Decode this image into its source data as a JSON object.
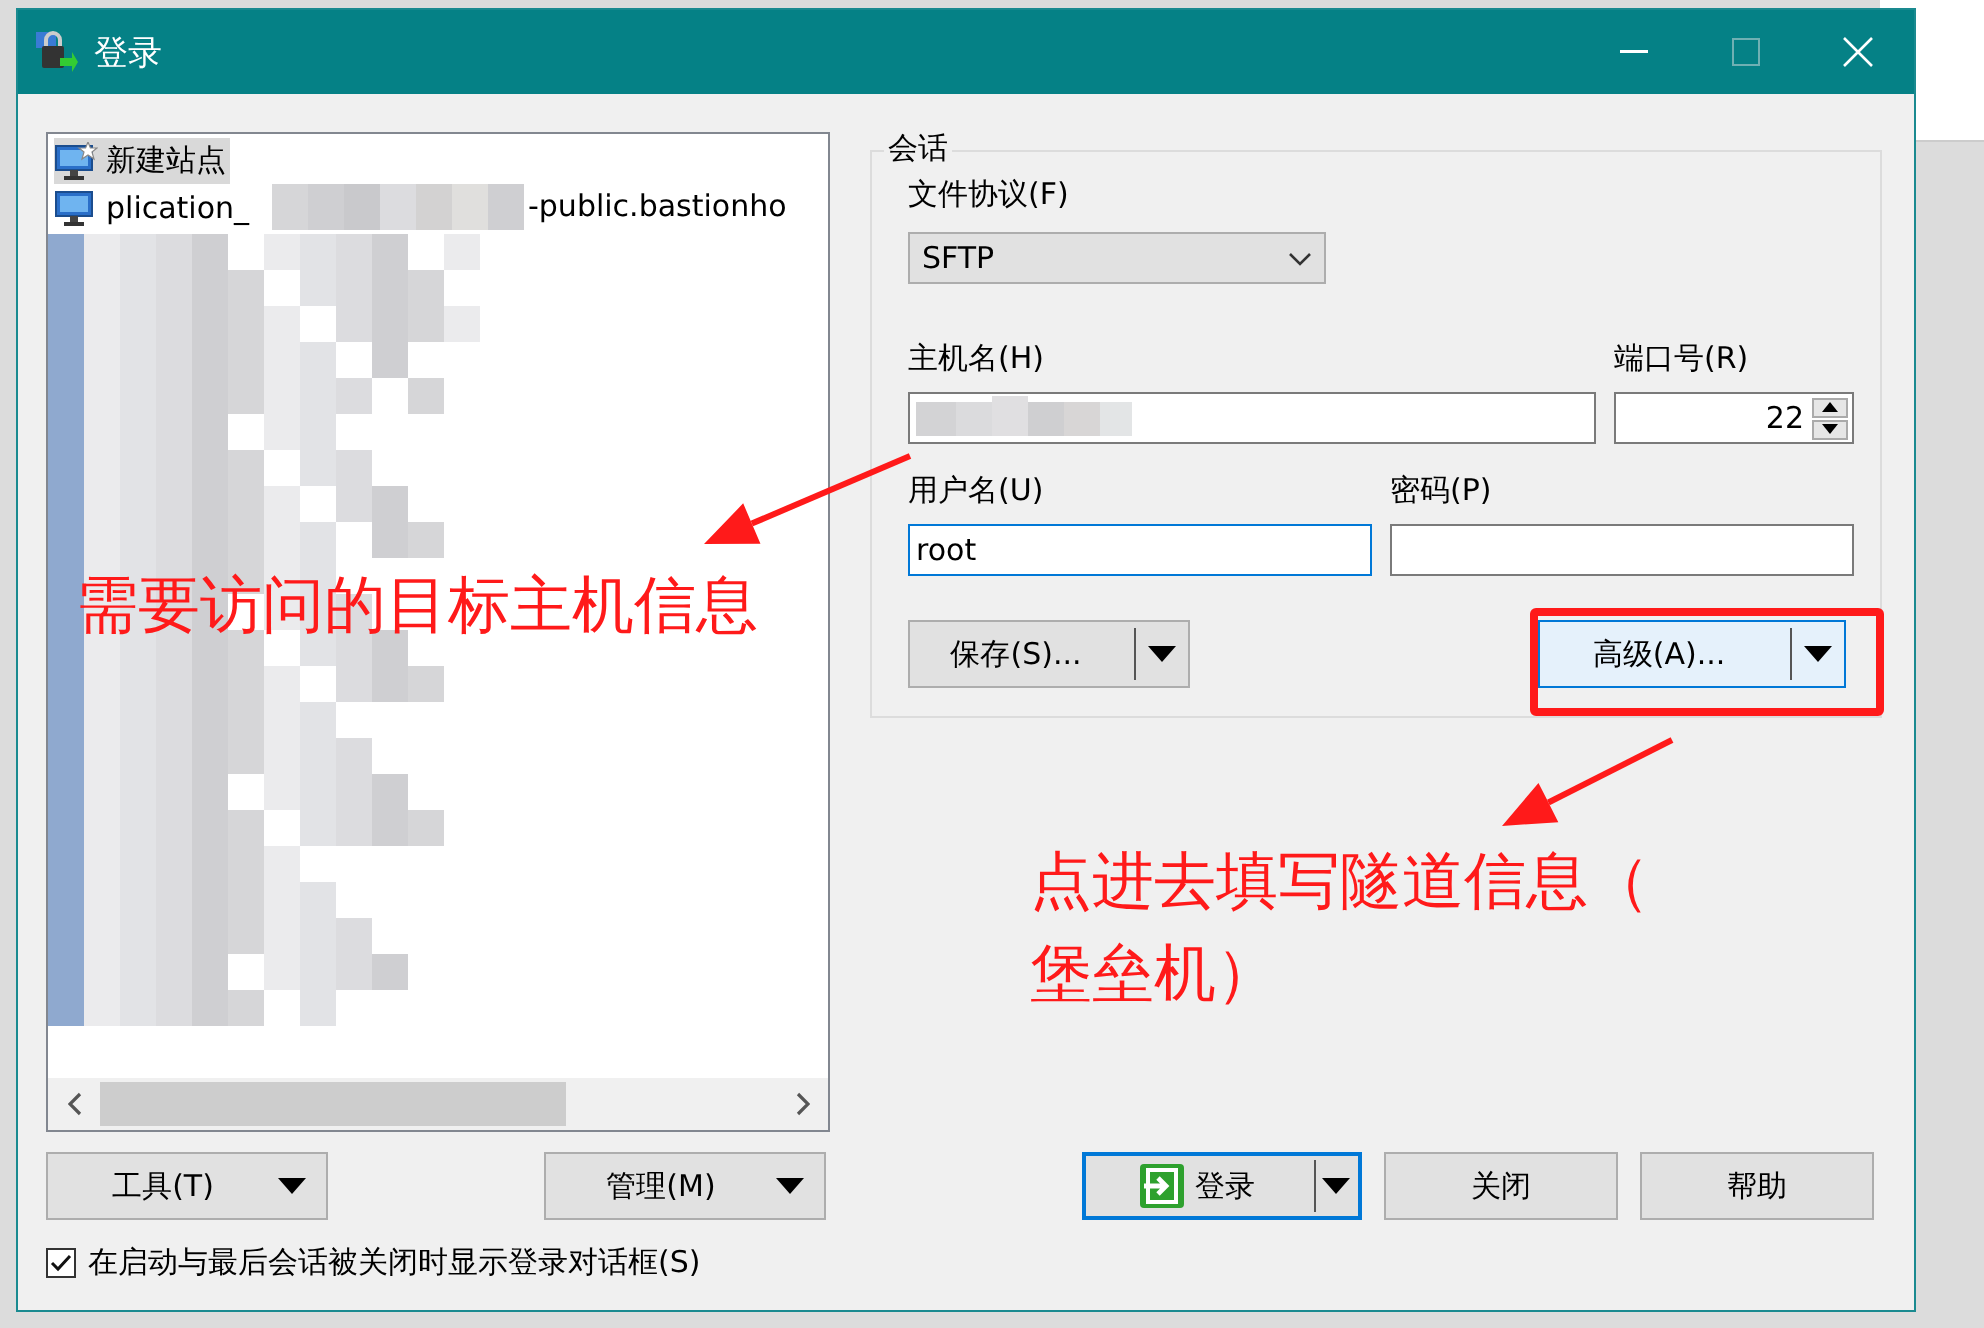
{
  "window": {
    "title": "登录"
  },
  "sites": [
    {
      "label": "新建站点",
      "kind": "new",
      "selected": true
    },
    {
      "label": "plication_",
      "label_tail": "-public.bastionho",
      "kind": "site",
      "selected": false
    }
  ],
  "tree_buttons": [
    "工具(T)",
    "管理(M)"
  ],
  "session": {
    "title": "会话",
    "protocol": {
      "label": "文件协议(F)",
      "value": "SFTP"
    },
    "host": {
      "label": "主机名(H)"
    },
    "port": {
      "label": "端口号(R)",
      "value": "22"
    },
    "user": {
      "label": "用户名(U)",
      "value": "root",
      "focused": true
    },
    "password": {
      "label": "密码(P)"
    },
    "save_button": "保存(S)...",
    "advanced_button": {
      "label": "高级(A)...",
      "hovered": true
    }
  },
  "buttons": [
    {
      "label": "登录",
      "kind": "default"
    },
    {
      "label": "关闭",
      "kind": "plain"
    },
    {
      "label": "帮助",
      "kind": "plain"
    }
  ],
  "show_on_startup": {
    "label": "在启动与最后会话被关闭时显示登录对话框(S)",
    "checked": true
  },
  "annotations": [
    {
      "kind": "callout",
      "lines": [
        "需要访问的目标主机信息"
      ]
    },
    {
      "kind": "callout",
      "lines": [
        "点进去填写隧道信息（",
        "堡垒机）"
      ]
    }
  ]
}
